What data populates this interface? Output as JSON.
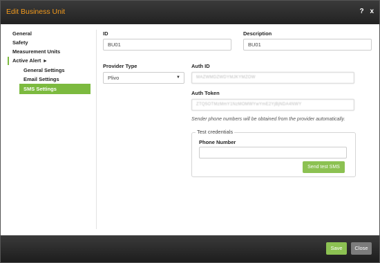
{
  "dialog": {
    "title": "Edit Business Unit",
    "help_icon": "?",
    "close_icon": "x"
  },
  "sidebar": {
    "items": [
      {
        "label": "General"
      },
      {
        "label": "Safety"
      },
      {
        "label": "Measurement Units"
      },
      {
        "label": "Active Alert"
      },
      {
        "label": "General Settings"
      },
      {
        "label": "Email Settings"
      },
      {
        "label": "SMS Settings"
      }
    ],
    "expanded_indicator": "▸"
  },
  "form": {
    "id_label": "ID",
    "id_value": "BU01",
    "description_label": "Description",
    "description_value": "BU01",
    "provider_type_label": "Provider Type",
    "provider_type_value": "Plivo",
    "auth_id_label": "Auth ID",
    "auth_id_value": "MAZWMDZWDYMJKYMZOW",
    "auth_token_label": "Auth Token",
    "auth_token_value": "ZTQ5OTMzMmY1NzMOMWYwYmE2YjBjNDA4NWY",
    "note": "Sender phone numbers will be obtained from the provider automatically.",
    "test_legend": "Test credentials",
    "phone_label": "Phone Number",
    "phone_value": "",
    "send_test_label": "Send test SMS"
  },
  "footer": {
    "save_label": "Save",
    "close_label": "Close"
  },
  "colors": {
    "accent_green": "#8cc152",
    "title_orange": "#f39a1c",
    "bar_dark": "#2a2a2a"
  }
}
